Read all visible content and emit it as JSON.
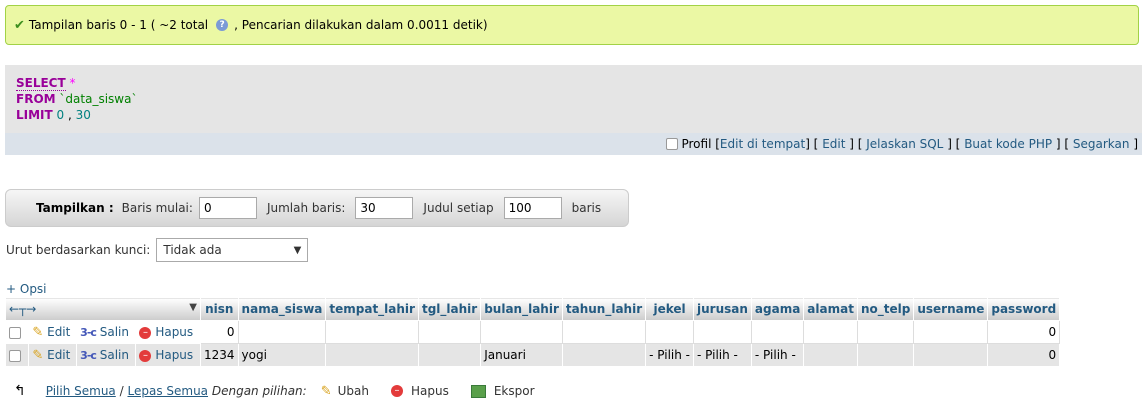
{
  "banner": {
    "text_before": "Tampilan baris 0 - 1 ( ~2 total",
    "text_after": ", Pencarian dilakukan dalam 0.0011 detik)"
  },
  "sql": {
    "select_kw": "SELECT",
    "star": "*",
    "from_kw": "FROM",
    "table": "`data_siswa`",
    "limit_kw": "LIMIT",
    "limit_start": "0",
    "comma": ",",
    "limit_count": "30",
    "profil_label": "Profil",
    "links": [
      "Edit di tempat",
      "Edit",
      "Jelaskan SQL",
      "Buat kode PHP",
      "Segarkan"
    ]
  },
  "nav": {
    "show_label": "Tampilkan :",
    "start_label": "Baris mulai:",
    "start_value": "0",
    "count_label": "Jumlah baris:",
    "count_value": "30",
    "header_label": "Judul setiap",
    "header_value": "100",
    "rows_label": "baris"
  },
  "sort": {
    "label": "Urut berdasarkan kunci:",
    "value": "Tidak ada"
  },
  "options_link": "+ Opsi",
  "table": {
    "columns": [
      "nisn",
      "nama_siswa",
      "tempat_lahir",
      "tgl_lahir",
      "bulan_lahir",
      "tahun_lahir",
      "jekel",
      "jurusan",
      "agama",
      "alamat",
      "no_telp",
      "username",
      "password"
    ],
    "actions": {
      "edit": "Edit",
      "copy": "Salin",
      "delete": "Hapus"
    },
    "rows": [
      [
        "0",
        "",
        "",
        "",
        "",
        "",
        "",
        "",
        "",
        "",
        "",
        "",
        "0"
      ],
      [
        "1234",
        "yogi",
        "",
        "",
        "Januari",
        "",
        "- Pilih -",
        "- Pilih -",
        "- Pilih -",
        "",
        "",
        "",
        "0"
      ]
    ]
  },
  "bottom": {
    "check_all": "Pilih Semua",
    "separator": "/",
    "uncheck_all": "Lepas Semua",
    "with_selected": "Dengan pilihan:",
    "change": "Ubah",
    "delete": "Hapus",
    "export": "Ekspor"
  }
}
